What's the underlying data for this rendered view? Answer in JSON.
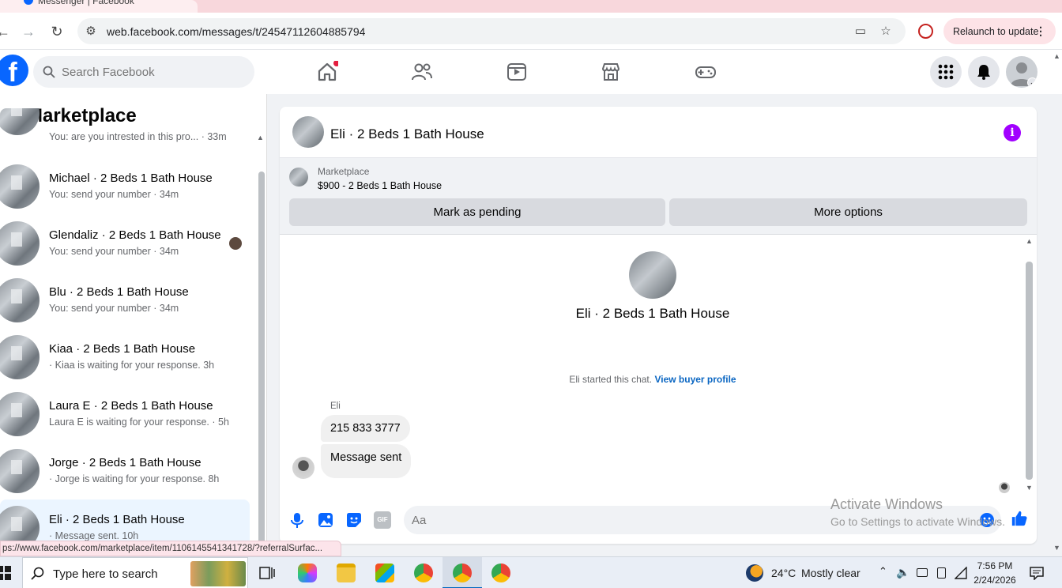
{
  "browser": {
    "tab_title": "Messenger | Facebook",
    "url": "web.facebook.com/messages/t/24547112604885794",
    "relaunch_label": "Relaunch to update",
    "status_url": "ps://www.facebook.com/marketplace/item/1106145541341728/?referralSurfac..."
  },
  "fb_header": {
    "logo": "f",
    "search_placeholder": "Search Facebook",
    "nav_icons": [
      "home-icon",
      "friends-icon",
      "video-icon",
      "marketplace-icon",
      "gaming-icon"
    ]
  },
  "left_panel": {
    "title": "Marketplace",
    "partial_item_sub": "You: are you intrested in this pro... · 33m",
    "conversations": [
      {
        "name": "Michael · 2 Beds 1 Bath House",
        "sub": "You: send your number · 34m"
      },
      {
        "name": "Glendaliz · 2 Beds 1 Bath House",
        "sub": "You: send your number · 34m"
      },
      {
        "name": "Blu · 2 Beds 1 Bath House",
        "sub": "You: send your number · 34m"
      },
      {
        "name": "Kiaa · 2 Beds 1 Bath House",
        "sub": "· Kiaa is waiting for your response. 3h"
      },
      {
        "name": "Laura E · 2 Beds 1 Bath House",
        "sub": "Laura E is waiting for your response. · 5h"
      },
      {
        "name": "Jorge · 2 Beds 1 Bath House",
        "sub": "· Jorge is waiting for your response. 8h"
      },
      {
        "name": "Eli · 2 Beds 1 Bath House",
        "sub": "· Message sent. 10h"
      }
    ]
  },
  "chat": {
    "title": "Eli · 2 Beds 1 Bath House",
    "marketplace_label": "Marketplace",
    "listing": "$900 - 2 Beds 1 Bath House",
    "mark_pending": "Mark as pending",
    "more_options": "More options",
    "profile_name": "Eli · 2 Beds 1 Bath House",
    "started_text": "Eli started this chat.",
    "buyer_profile_link": "View buyer profile",
    "sender_name": "Eli",
    "messages": [
      "215 833 3777",
      "Message sent"
    ],
    "composer_placeholder": "Aa"
  },
  "watermark": {
    "line1": "Activate Windows",
    "line2": "Go to Settings to activate Windows."
  },
  "taskbar": {
    "search_placeholder": "Type here to search",
    "weather_temp": "24°C",
    "weather_text": "Mostly clear",
    "time": "7:56 PM",
    "date": "2/24/2026"
  }
}
